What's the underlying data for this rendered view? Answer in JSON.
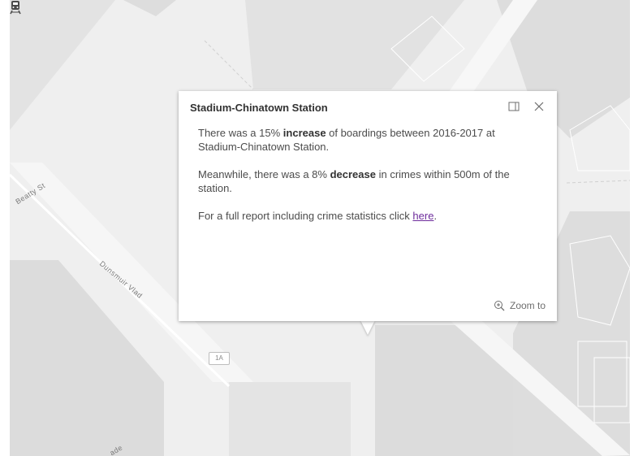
{
  "map": {
    "street_labels": {
      "beatty": "Beatty St",
      "dunsmuir": "Dunsmuir Vlad",
      "bottom": "ade"
    },
    "route_shield": "1A",
    "station_icon": "train-icon",
    "colors": {
      "background": "#efefef",
      "block": "#dddddd",
      "road": "#fafafa"
    }
  },
  "popup": {
    "title": "Stadium-Chinatown Station",
    "dock_icon": "dock-icon",
    "close_icon": "close-icon",
    "p1": {
      "before": "There was a 15% ",
      "bold": "increase",
      "after": " of boardings between 2016-2017 at Stadium-Chinatown Station."
    },
    "p2": {
      "before": "Meanwhile, there was a 8% ",
      "bold": "decrease",
      "after": " in crimes within 500m of the station."
    },
    "p3": {
      "before": "For a full report including crime statistics click ",
      "link": "here",
      "after": "."
    },
    "zoom_label": "Zoom to",
    "link_color": "#6e2c9c"
  }
}
